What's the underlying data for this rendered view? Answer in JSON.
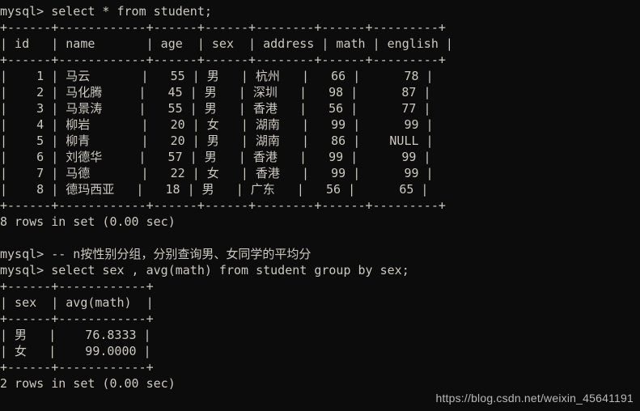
{
  "terminal": {
    "background_color": "#0c0c0c",
    "text_color": "#ccc9c2",
    "prompt": "mysql>",
    "watermark": "https://blog.csdn.net/weixin_45641191"
  },
  "session": {
    "lines": [
      "mysql> select * from student;",
      "+------+------------+------+------+--------+------+---------+",
      "| id   | name       | age  | sex  | address | math | english |",
      "+------+------------+------+------+--------+------+---------+",
      "|    1 | 马云       |   55 | 男   | 杭州   |   66 |      78 |",
      "|    2 | 马化腾     |   45 | 男   | 深圳   |   98 |      87 |",
      "|    3 | 马景涛     |   55 | 男   | 香港   |   56 |      77 |",
      "|    4 | 柳岩       |   20 | 女   | 湖南   |   99 |      99 |",
      "|    5 | 柳青       |   20 | 男   | 湖南   |   86 |    NULL |",
      "|    6 | 刘德华     |   57 | 男   | 香港   |   99 |      99 |",
      "|    7 | 马德       |   22 | 女   | 香港   |   99 |      99 |",
      "|    8 | 德玛西亚   |   18 | 男   | 广东   |   56 |      65 |",
      "+------+------------+------+------+--------+------+---------+",
      "8 rows in set (0.00 sec)",
      "",
      "mysql> -- n按性别分组，分别查询男、女同学的平均分",
      "mysql> select sex , avg(math) from student group by sex;",
      "+------+------------+",
      "| sex  | avg(math)  |",
      "+------+------------+",
      "| 男   |    76.8333 |",
      "| 女   |    99.0000 |",
      "+------+------------+",
      "2 rows in set (0.00 sec)"
    ]
  },
  "queries": [
    {
      "label": "select-all-students",
      "prompt": "mysql>",
      "sql": "select * from student;",
      "status": "8 rows in set (0.00 sec)"
    },
    {
      "label": "comment-group-by-sex",
      "prompt": "mysql>",
      "sql": "-- n按性别分组，分别查询男、女同学的平均分",
      "status": ""
    },
    {
      "label": "avg-math-group-by-sex",
      "prompt": "mysql>",
      "sql": "select sex , avg(math) from student group by sex;",
      "status": "2 rows in set (0.00 sec)"
    }
  ],
  "student_table": {
    "columns": [
      "id",
      "name",
      "age",
      "sex",
      "address",
      "math",
      "english"
    ],
    "rows": [
      [
        "1",
        "马云",
        "55",
        "男",
        "杭州",
        "66",
        "78"
      ],
      [
        "2",
        "马化腾",
        "45",
        "男",
        "深圳",
        "98",
        "87"
      ],
      [
        "3",
        "马景涛",
        "55",
        "男",
        "香港",
        "56",
        "77"
      ],
      [
        "4",
        "柳岩",
        "20",
        "女",
        "湖南",
        "99",
        "99"
      ],
      [
        "5",
        "柳青",
        "20",
        "男",
        "湖南",
        "86",
        "NULL"
      ],
      [
        "6",
        "刘德华",
        "57",
        "男",
        "香港",
        "99",
        "99"
      ],
      [
        "7",
        "马德",
        "22",
        "女",
        "香港",
        "99",
        "99"
      ],
      [
        "8",
        "德玛西亚",
        "18",
        "男",
        "广东",
        "56",
        "65"
      ]
    ],
    "row_count_text": "8 rows in set (0.00 sec)"
  },
  "avg_table": {
    "columns": [
      "sex",
      "avg(math)"
    ],
    "rows": [
      [
        "男",
        "76.8333"
      ],
      [
        "女",
        "99.0000"
      ]
    ],
    "row_count_text": "2 rows in set (0.00 sec)"
  }
}
